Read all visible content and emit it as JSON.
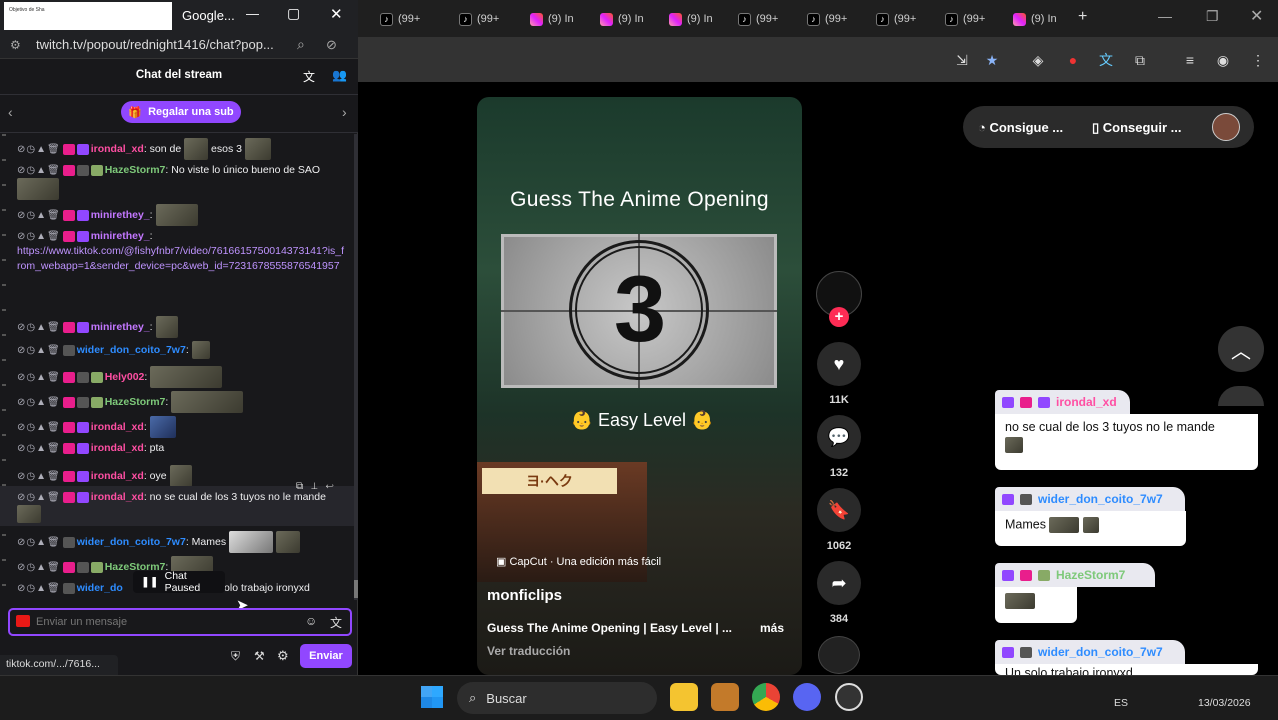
{
  "browser": {
    "popup_title": "Google...",
    "thumb_text": "Objetivo de Sha",
    "popup_url": "twitch.tv/popout/rednight1416/chat?pop...",
    "tabs": [
      {
        "icon": "tiktok",
        "label": "(99+"
      },
      {
        "icon": "tiktok",
        "label": "(99+"
      },
      {
        "icon": "instagram",
        "label": "(9) In"
      },
      {
        "icon": "instagram",
        "label": "(9) In"
      },
      {
        "icon": "instagram",
        "label": "(9) In"
      },
      {
        "icon": "tiktok",
        "label": "(99+"
      },
      {
        "icon": "tiktok",
        "label": "(99+"
      },
      {
        "icon": "tiktok",
        "label": "(99+"
      },
      {
        "icon": "tiktok",
        "label": "(99+"
      },
      {
        "icon": "instagram",
        "label": "(9) In"
      }
    ],
    "new_tab": "+",
    "status_url": "tiktok.com/.../7616..."
  },
  "chat": {
    "header": "Chat del stream",
    "gift_label": "Regalar una sub",
    "paused": "Chat Paused",
    "placeholder": "Enviar un mensaje",
    "send": "Enviar",
    "messages": [
      {
        "user": "irondal_xd",
        "text": "son de",
        "extra": "esos 3"
      },
      {
        "user": "HazeStorm7",
        "text": "No viste lo único bueno de SAO"
      },
      {
        "user": "minirethey_",
        "text": ""
      },
      {
        "user": "minirethey_",
        "text": "https://www.tiktok.com/@fishyfnbr7/video/7616615750014373141?is_from_webapp=1&sender_device=pc&web_id=7231678555876541957"
      },
      {
        "user": "minirethey_",
        "text": ""
      },
      {
        "user": "wider_don_coito_7w7",
        "text": ""
      },
      {
        "user": "Hely002",
        "text": ""
      },
      {
        "user": "HazeStorm7",
        "text": ""
      },
      {
        "user": "irondal_xd",
        "text": ""
      },
      {
        "user": "irondal_xd",
        "text": "pta"
      },
      {
        "user": "irondal_xd",
        "text": "oye"
      },
      {
        "user": "irondal_xd",
        "text": "no se cual de los 3 tuyos no le mande"
      },
      {
        "user": "wider_don_coito_7w7",
        "text": "Mames"
      },
      {
        "user": "HazeStorm7",
        "text": ""
      },
      {
        "user": "wider_do",
        "text": "solo trabajo ironyxd"
      }
    ]
  },
  "video": {
    "title": "Guess The Anime Opening",
    "countdown": "3",
    "level": "Easy Level",
    "shop_sign": "ヨ·ヘク",
    "capcut": "CapCut · Una edición más fácil",
    "author": "monficlips",
    "description": "Guess The Anime Opening | Easy Level | ...",
    "more": "más",
    "translate": "Ver traducción",
    "likes": "11K",
    "comments": "132",
    "saves": "1062",
    "shares": "384"
  },
  "page": {
    "get_app_1": "Consigue ...",
    "get_app_2": "Conseguir ..."
  },
  "overlay": [
    {
      "user": "irondal_xd",
      "text": "no se cual de los 3 tuyos no le mande"
    },
    {
      "user": "wider_don_coito_7w7",
      "text": "Mames"
    },
    {
      "user": "HazeStorm7",
      "text": ""
    },
    {
      "user": "wider_don_coito_7w7",
      "text": "Un solo trabajo ironyxd"
    }
  ],
  "taskbar": {
    "search": "Buscar",
    "lang": "ES",
    "date": "13/03/2026"
  },
  "colors": {
    "twitch_purple": "#9147ff",
    "tiktok_red": "#fe2c55"
  }
}
